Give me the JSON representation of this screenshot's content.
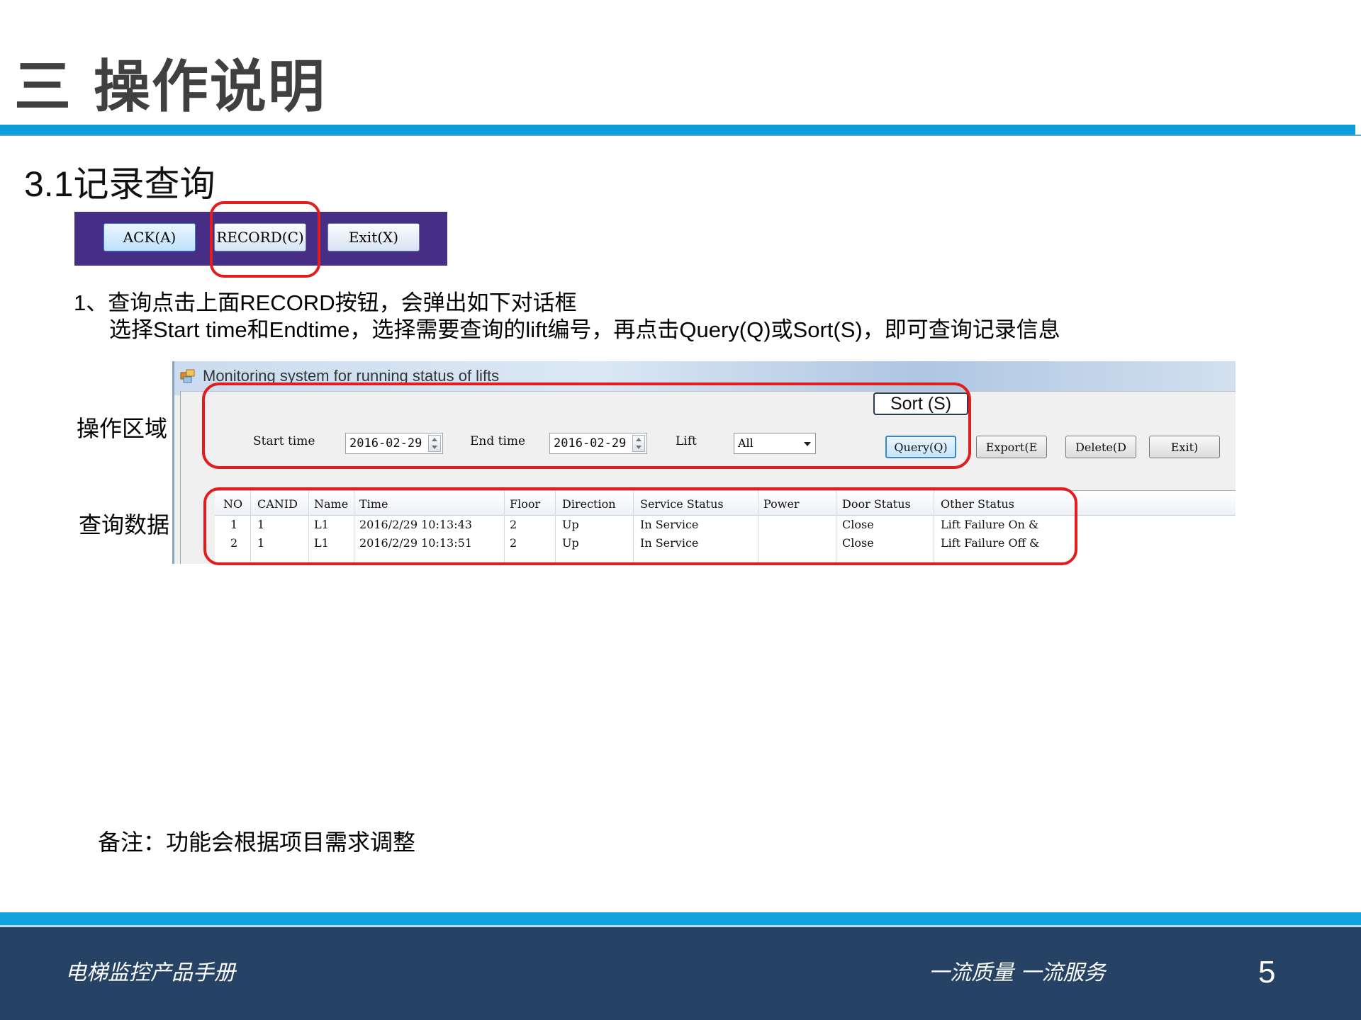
{
  "header": {
    "page_title": "三 操作说明",
    "section_title": "3.1记录查询"
  },
  "toolbar": {
    "ack_label": "ACK(A)",
    "record_label": "RECORD(C)",
    "exit_label": "Exit(X)"
  },
  "instructions": {
    "line1": "1、查询点击上面RECORD按钮，会弹出如下对话框",
    "line2": "选择Start time和Endtime，选择需要查询的lift编号，再点击Query(Q)或Sort(S)，即可查询记录信息"
  },
  "side_labels": {
    "operation_area": "操作区域",
    "query_data": "查询数据"
  },
  "dialog": {
    "title": "Monitoring system for running status of lifts",
    "start_time_label": "Start time",
    "start_time_value": "2016-02-29",
    "end_time_label": "End time",
    "end_time_value": "2016-02-29",
    "lift_label": "Lift",
    "lift_value": "All",
    "sort_callout": "Sort (S)",
    "buttons": {
      "query": "Query(Q)",
      "export": "Export(E",
      "delete": "Delete(D",
      "exit": "Exit)"
    }
  },
  "table": {
    "columns": [
      "NO",
      "CANID",
      "Name",
      "Time",
      "Floor",
      "Direction",
      "Service Status",
      "Power",
      "Door Status",
      "Other Status"
    ],
    "rows": [
      [
        "1",
        "1",
        "L1",
        "2016/2/29 10:13:43",
        "2",
        "Up",
        "In Service",
        "",
        "Close",
        "Lift Failure On &"
      ],
      [
        "2",
        "1",
        "L1",
        "2016/2/29 10:13:51",
        "2",
        "Up",
        "In Service",
        "",
        "Close",
        "Lift Failure Off &"
      ]
    ]
  },
  "note": "备注：功能会根据项目需求调整",
  "footer": {
    "manual_title": "电梯监控产品手册",
    "slogan": "一流质量 一流服务",
    "page_number": "5"
  },
  "colors": {
    "accent_blue": "#0b9ddb",
    "footer_navy": "#264264",
    "highlight_red": "#e31d1d",
    "toolbar_purple": "#462e86"
  }
}
